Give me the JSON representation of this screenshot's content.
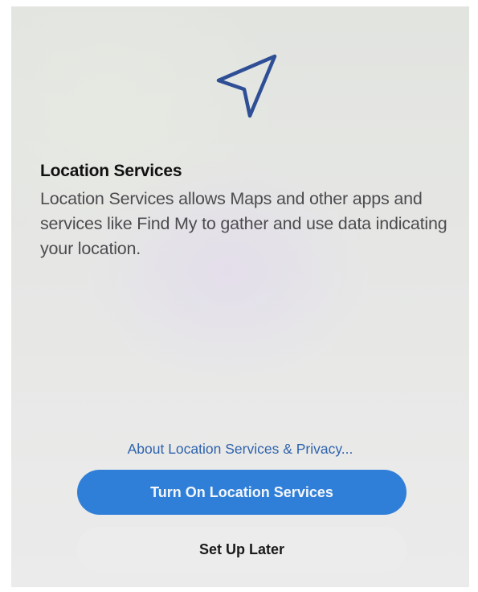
{
  "screen": {
    "icon": "location-arrow-icon",
    "title": "Location Services",
    "description": "Location Services allows Maps and other apps and services like Find My to gather and use data indicating your location.",
    "privacy_link": "About Location Services & Privacy...",
    "primary_button": "Turn On Location Services",
    "secondary_button": "Set Up Later"
  },
  "colors": {
    "accent": "#2f7fd9",
    "link": "#2f63ad",
    "icon_stroke": "#2e4f96"
  }
}
